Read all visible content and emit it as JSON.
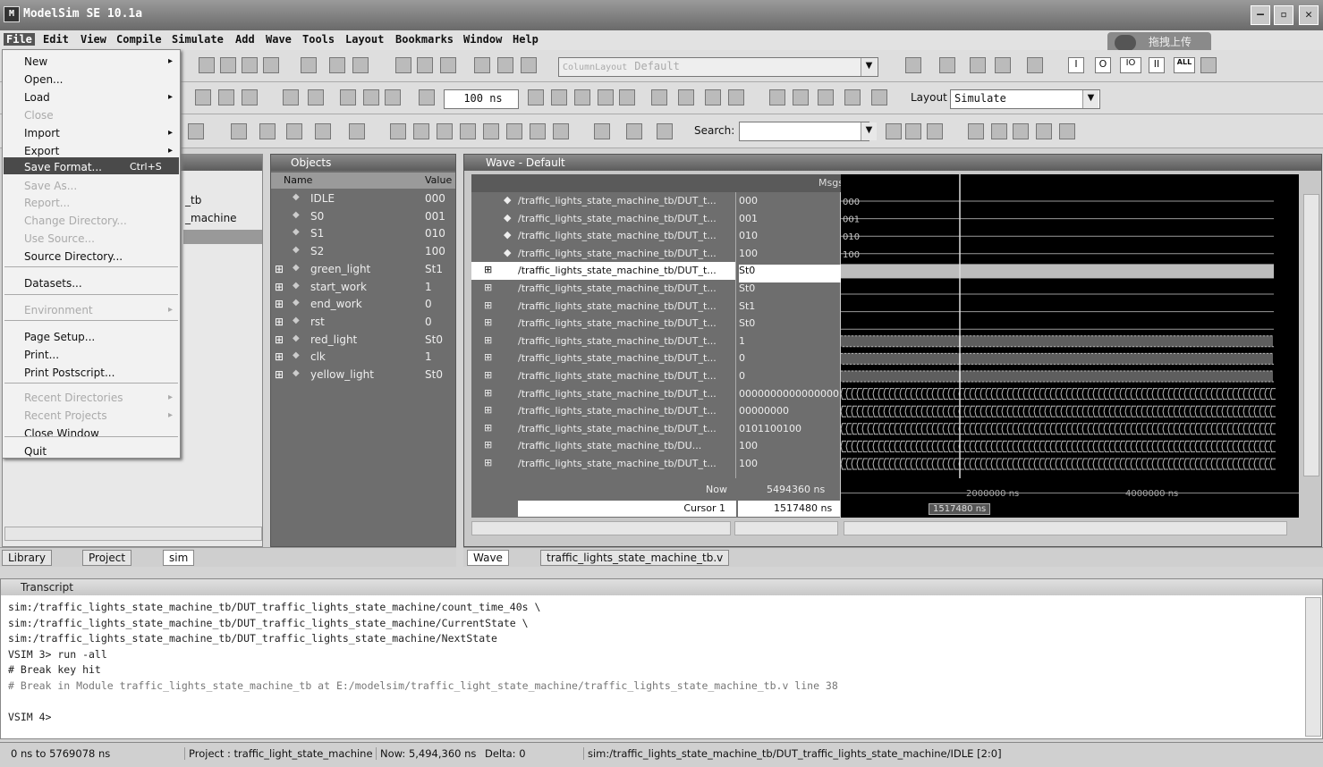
{
  "window": {
    "title": "ModelSim SE 10.1a",
    "upload_label": "拖拽上传"
  },
  "menubar": [
    "File",
    "Edit",
    "View",
    "Compile",
    "Simulate",
    "Add",
    "Wave",
    "Tools",
    "Layout",
    "Bookmarks",
    "Window",
    "Help"
  ],
  "file_menu": {
    "items": [
      {
        "label": "New",
        "submenu": true,
        "enabled": true
      },
      {
        "label": "Open...",
        "enabled": true
      },
      {
        "label": "Load",
        "submenu": true,
        "enabled": true
      },
      {
        "label": "Close",
        "enabled": false
      },
      {
        "label": "Import",
        "submenu": true,
        "enabled": true
      },
      {
        "label": "Export",
        "submenu": true,
        "enabled": true
      },
      {
        "label": "Save Format...",
        "shortcut": "Ctrl+S",
        "enabled": true,
        "highlighted": true
      },
      {
        "label": "Save As...",
        "enabled": false
      },
      {
        "label": "Report...",
        "enabled": false
      },
      {
        "label": "Change Directory...",
        "enabled": false
      },
      {
        "label": "Use Source...",
        "enabled": false
      },
      {
        "label": "Source Directory...",
        "enabled": true
      },
      {
        "label": "Datasets...",
        "enabled": true
      },
      {
        "label": "Environment",
        "submenu": true,
        "enabled": false
      },
      {
        "label": "Page Setup...",
        "enabled": true
      },
      {
        "label": "Print...",
        "enabled": true
      },
      {
        "label": "Print Postscript...",
        "enabled": true
      },
      {
        "label": "Recent Directories",
        "submenu": true,
        "enabled": false
      },
      {
        "label": "Recent Projects",
        "submenu": true,
        "enabled": false
      },
      {
        "label": "Close Window",
        "enabled": true
      },
      {
        "label": "Quit",
        "enabled": true
      }
    ]
  },
  "toolbar": {
    "column_layout_label": "ColumnLayout",
    "column_layout_value": "Default",
    "run_length": "100 ns",
    "layout_label": "Layout",
    "layout_value": "Simulate",
    "search_label": "Search:",
    "search_value": "",
    "radix_buttons": [
      "I",
      "O",
      "IO",
      "II",
      "ALL"
    ]
  },
  "library_panel": {
    "items": [
      "_tb",
      "_machine"
    ]
  },
  "objects": {
    "title": "Objects",
    "columns": [
      "Name",
      "Value"
    ],
    "rows": [
      {
        "name": "IDLE",
        "value": "000",
        "expandable": false
      },
      {
        "name": "S0",
        "value": "001",
        "expandable": false
      },
      {
        "name": "S1",
        "value": "010",
        "expandable": false
      },
      {
        "name": "S2",
        "value": "100",
        "expandable": false
      },
      {
        "name": "green_light",
        "value": "St1",
        "expandable": true
      },
      {
        "name": "start_work",
        "value": "1",
        "expandable": true
      },
      {
        "name": "end_work",
        "value": "0",
        "expandable": true
      },
      {
        "name": "rst",
        "value": "0",
        "expandable": true
      },
      {
        "name": "red_light",
        "value": "St0",
        "expandable": true
      },
      {
        "name": "clk",
        "value": "1",
        "expandable": true
      },
      {
        "name": "yellow_light",
        "value": "St0",
        "expandable": true
      }
    ]
  },
  "wave": {
    "title": "Wave - Default",
    "msgs_header": "Msgs",
    "signals": [
      {
        "path": "/traffic_lights_state_machine_tb/DUT_t...",
        "value": "000",
        "kind": "const"
      },
      {
        "path": "/traffic_lights_state_machine_tb/DUT_t...",
        "value": "001",
        "kind": "const"
      },
      {
        "path": "/traffic_lights_state_machine_tb/DUT_t...",
        "value": "010",
        "kind": "const"
      },
      {
        "path": "/traffic_lights_state_machine_tb/DUT_t...",
        "value": "100",
        "kind": "const"
      },
      {
        "path": "/traffic_lights_state_machine_tb/DUT_t...",
        "value": "St0",
        "kind": "selected"
      },
      {
        "path": "/traffic_lights_state_machine_tb/DUT_t...",
        "value": "St0",
        "kind": "low"
      },
      {
        "path": "/traffic_lights_state_machine_tb/DUT_t...",
        "value": "St1",
        "kind": "low"
      },
      {
        "path": "/traffic_lights_state_machine_tb/DUT_t...",
        "value": "St0",
        "kind": "low"
      },
      {
        "path": "/traffic_lights_state_machine_tb/DUT_t...",
        "value": "1",
        "kind": "clock"
      },
      {
        "path": "/traffic_lights_state_machine_tb/DUT_t...",
        "value": "0",
        "kind": "clock"
      },
      {
        "path": "/traffic_lights_state_machine_tb/DUT_t...",
        "value": "0",
        "kind": "clock"
      },
      {
        "path": "/traffic_lights_state_machine_tb/DUT_t...",
        "value": "0000000000000000",
        "kind": "bus"
      },
      {
        "path": "/traffic_lights_state_machine_tb/DUT_t...",
        "value": "00000000",
        "kind": "bus"
      },
      {
        "path": "/traffic_lights_state_machine_tb/DUT_t...",
        "value": "0101100100",
        "kind": "bus"
      },
      {
        "path": "/traffic_lights_state_machine_tb/DU...",
        "value": "100",
        "kind": "bus"
      },
      {
        "path": "/traffic_lights_state_machine_tb/DUT_t...",
        "value": "100",
        "kind": "bus"
      }
    ],
    "now_label": "Now",
    "now_value": "5494360 ns",
    "cursor_label": "Cursor 1",
    "cursor_value": "1517480 ns",
    "cursor_tag": "1517480 ns",
    "ruler": [
      "2000000 ns",
      "4000000 ns"
    ]
  },
  "left_tabs": [
    "Library",
    "Project",
    "sim"
  ],
  "wave_tabs": [
    "Wave",
    "traffic_lights_state_machine_tb.v"
  ],
  "transcript": {
    "title": "Transcript",
    "lines": [
      "sim:/traffic_lights_state_machine_tb/DUT_traffic_lights_state_machine/count_time_40s \\",
      "sim:/traffic_lights_state_machine_tb/DUT_traffic_lights_state_machine/CurrentState \\",
      "sim:/traffic_lights_state_machine_tb/DUT_traffic_lights_state_machine/NextState",
      "VSIM 3> run -all",
      "# Break key hit",
      "# Break in Module traffic_lights_state_machine_tb at E:/modelsim/traffic_light_state_machine/traffic_lights_state_machine_tb.v line 38",
      "",
      "VSIM 4>"
    ]
  },
  "statusbar": {
    "range": "0 ns to 5769078 ns",
    "project": "Project : traffic_light_state_machine",
    "now": "Now: 5,494,360 ns",
    "delta": "Delta: 0",
    "signal": "sim:/traffic_lights_state_machine_tb/DUT_traffic_lights_state_machine/IDLE [2:0]"
  }
}
